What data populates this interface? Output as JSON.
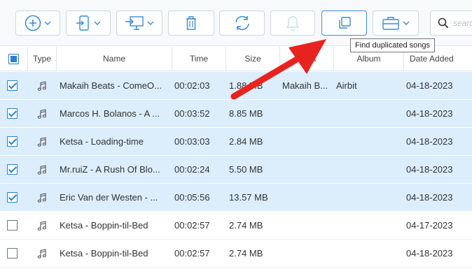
{
  "toolbar": {
    "buttons": [
      {
        "name": "add-button",
        "icon": "plus-circle-icon"
      },
      {
        "name": "export-to-device-button",
        "icon": "phone-export-icon"
      },
      {
        "name": "export-to-computer-button",
        "icon": "computer-export-icon"
      },
      {
        "name": "delete-button",
        "icon": "trash-icon"
      },
      {
        "name": "refresh-button",
        "icon": "refresh-icon"
      },
      {
        "name": "ringtone-button",
        "icon": "bell-icon"
      },
      {
        "name": "find-duplicates-button",
        "icon": "duplicate-icon"
      },
      {
        "name": "toolbox-button",
        "icon": "briefcase-icon"
      }
    ],
    "search_placeholder": "search",
    "tooltip": "Find duplicated songs"
  },
  "table": {
    "headers": {
      "type": "Type",
      "name": "Name",
      "time": "Time",
      "size": "Size",
      "artist": "Artist",
      "album": "Album",
      "date_added": "Date Added"
    },
    "rows": [
      {
        "checked": true,
        "name": "Makaih Beats - ComeO...",
        "time": "00:02:03",
        "size": "1.88 MB",
        "artist": "Makaih B...",
        "album": "Airbit",
        "date": "04-18-2023"
      },
      {
        "checked": true,
        "name": "Marcos H. Bolanos - A ...",
        "time": "00:03:52",
        "size": "8.85 MB",
        "artist": "",
        "album": "",
        "date": "04-18-2023"
      },
      {
        "checked": true,
        "name": "Ketsa - Loading-time",
        "time": "00:03:03",
        "size": "2.84 MB",
        "artist": "",
        "album": "",
        "date": "04-18-2023"
      },
      {
        "checked": true,
        "name": "Mr.ruiZ - A Rush Of Blo...",
        "time": "00:02:24",
        "size": "5.50 MB",
        "artist": "",
        "album": "",
        "date": "04-18-2023"
      },
      {
        "checked": true,
        "name": "Eric Van der Westen - ...",
        "time": "00:05:56",
        "size": "13.57 MB",
        "artist": "",
        "album": "",
        "date": "04-18-2023"
      },
      {
        "checked": false,
        "name": "Ketsa - Boppin-til-Bed",
        "time": "00:02:57",
        "size": "2.74 MB",
        "artist": "",
        "album": "",
        "date": "04-17-2023"
      },
      {
        "checked": false,
        "name": "Ketsa - Boppin-til-Bed",
        "time": "00:02:57",
        "size": "2.74 MB",
        "artist": "",
        "album": "",
        "date": "04-18-2023"
      }
    ]
  },
  "colors": {
    "accent": "#2a7fd2",
    "selected_row": "#dcedfc",
    "arrow": "#e8231f"
  }
}
